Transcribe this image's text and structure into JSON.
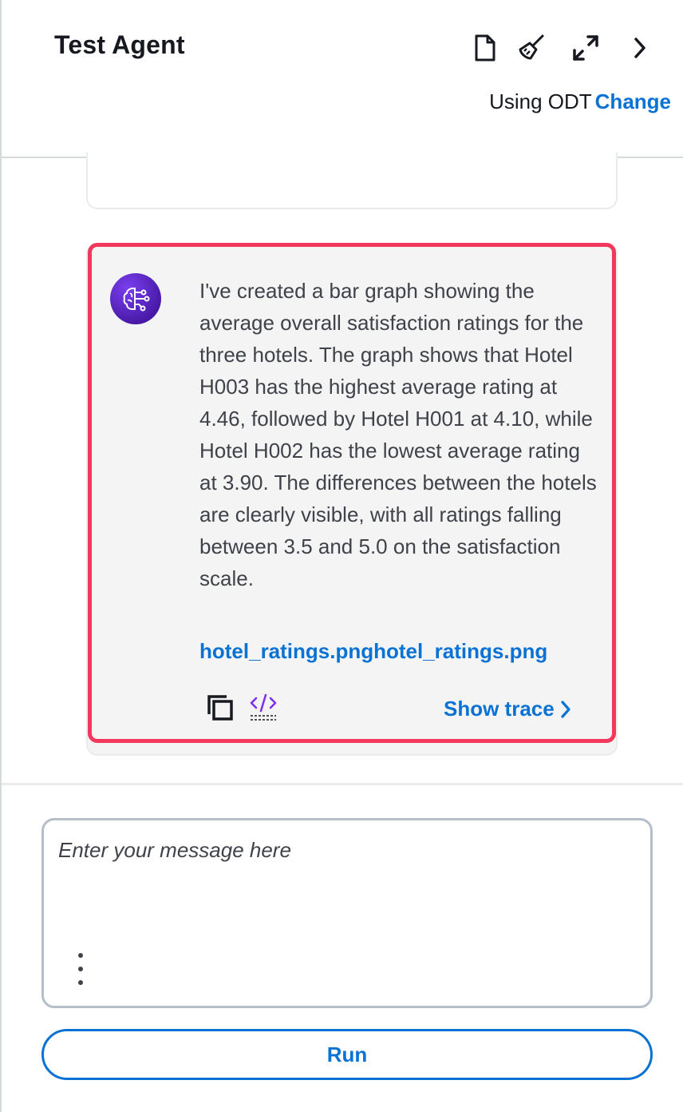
{
  "header": {
    "title": "Test Agent",
    "using_label": "Using ODT",
    "change_label": "Change",
    "icons": [
      "document-icon",
      "broom-icon",
      "expand-icon",
      "chevron-right-icon"
    ]
  },
  "message": {
    "text": "I've created a bar graph showing the average overall satisfaction ratings for the three hotels. The graph shows that Hotel H003 has the highest average rating at 4.46, followed by Hotel H001 at 4.10, while Hotel H002 has the lowest average rating at 3.90. The differences between the hotels are clearly visible, with all ratings falling between 3.5 and 5.0 on the satisfaction scale.",
    "file_link": "hotel_ratings.pnghotel_ratings.png",
    "show_trace_label": "Show trace",
    "highlight_color": "#f2395d",
    "avatar_icon": "ai-brain-icon"
  },
  "composer": {
    "placeholder": "Enter your message here",
    "value": "",
    "run_label": "Run"
  },
  "colors": {
    "accent": "#0972d3",
    "avatar": "#5b21c9"
  }
}
